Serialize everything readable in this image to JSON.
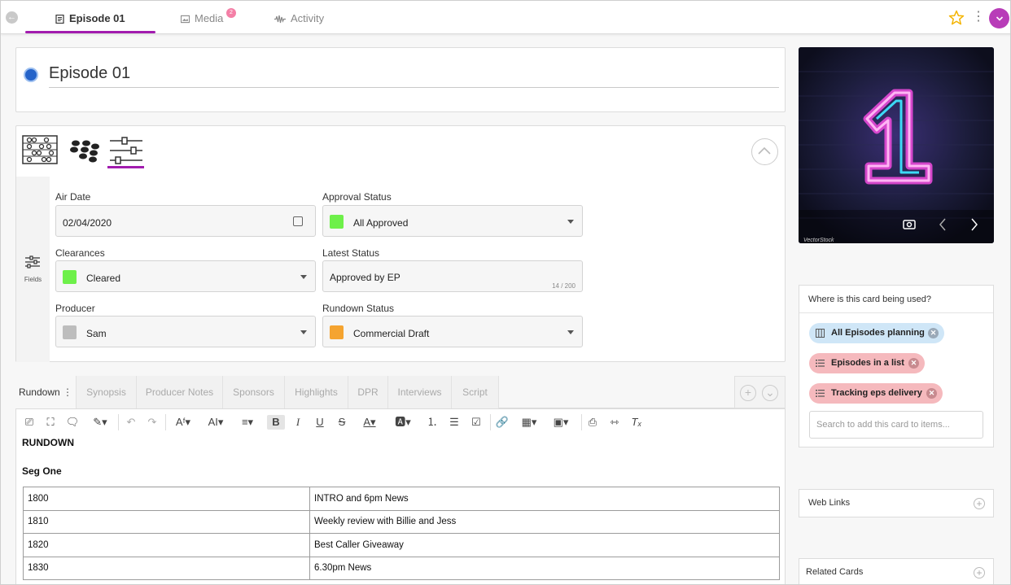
{
  "topbar": {
    "tabs": [
      {
        "label": "Episode 01",
        "icon": "document-icon",
        "active": true
      },
      {
        "label": "Media",
        "icon": "media-icon",
        "badge": "2"
      },
      {
        "label": "Activity",
        "icon": "activity-icon"
      }
    ],
    "accent_color": "#a21caf",
    "avatar_icon": "chevron-down-icon"
  },
  "title": {
    "text": "Episode 01"
  },
  "fields_panel": {
    "strip_label": "Fields",
    "fields": {
      "air_date": {
        "label": "Air Date",
        "value": "02/04/2020"
      },
      "approval_status": {
        "label": "Approval Status",
        "value": "All Approved",
        "color": "#6ef04a"
      },
      "clearances": {
        "label": "Clearances",
        "value": "Cleared",
        "color": "#6ef04a"
      },
      "latest_status": {
        "label": "Latest Status",
        "value": "Approved by EP",
        "count": "14 / 200"
      },
      "producer": {
        "label": "Producer",
        "value": "Sam",
        "color": "#bdbdbd"
      },
      "rundown_status": {
        "label": "Rundown Status",
        "value": "Commercial Draft",
        "color": "#f5a430"
      }
    }
  },
  "editor": {
    "tabs": [
      "Rundown",
      "Synopsis",
      "Producer Notes",
      "Sponsors",
      "Highlights",
      "DPR",
      "Interviews",
      "Script"
    ],
    "active_tab": "Rundown",
    "heading": "RUNDOWN",
    "segment": "Seg One",
    "rows": [
      [
        "1800",
        "INTRO and 6pm News"
      ],
      [
        "1810",
        "Weekly review with Billie and Jess"
      ],
      [
        "1820",
        "Best Caller Giveaway"
      ],
      [
        "1830",
        "6.30pm News"
      ]
    ]
  },
  "media": {
    "watermark": "VectorStock",
    "image_icon": "neon-number-one-icon"
  },
  "usage": {
    "title": "Where is this card being used?",
    "chips": [
      {
        "label": "All Episodes planning",
        "color": "#cfe6f7",
        "x_color": "#9aa9b8"
      },
      {
        "label": "Episodes in a list",
        "color": "#f5b9bd",
        "x_color": "#c88a8f"
      },
      {
        "label": "Tracking eps delivery",
        "color": "#f5b9bd",
        "x_color": "#c88a8f"
      }
    ],
    "search_placeholder": "Search to add this card to items..."
  },
  "side_cards": {
    "web_links": "Web Links",
    "related_cards": "Related Cards"
  }
}
